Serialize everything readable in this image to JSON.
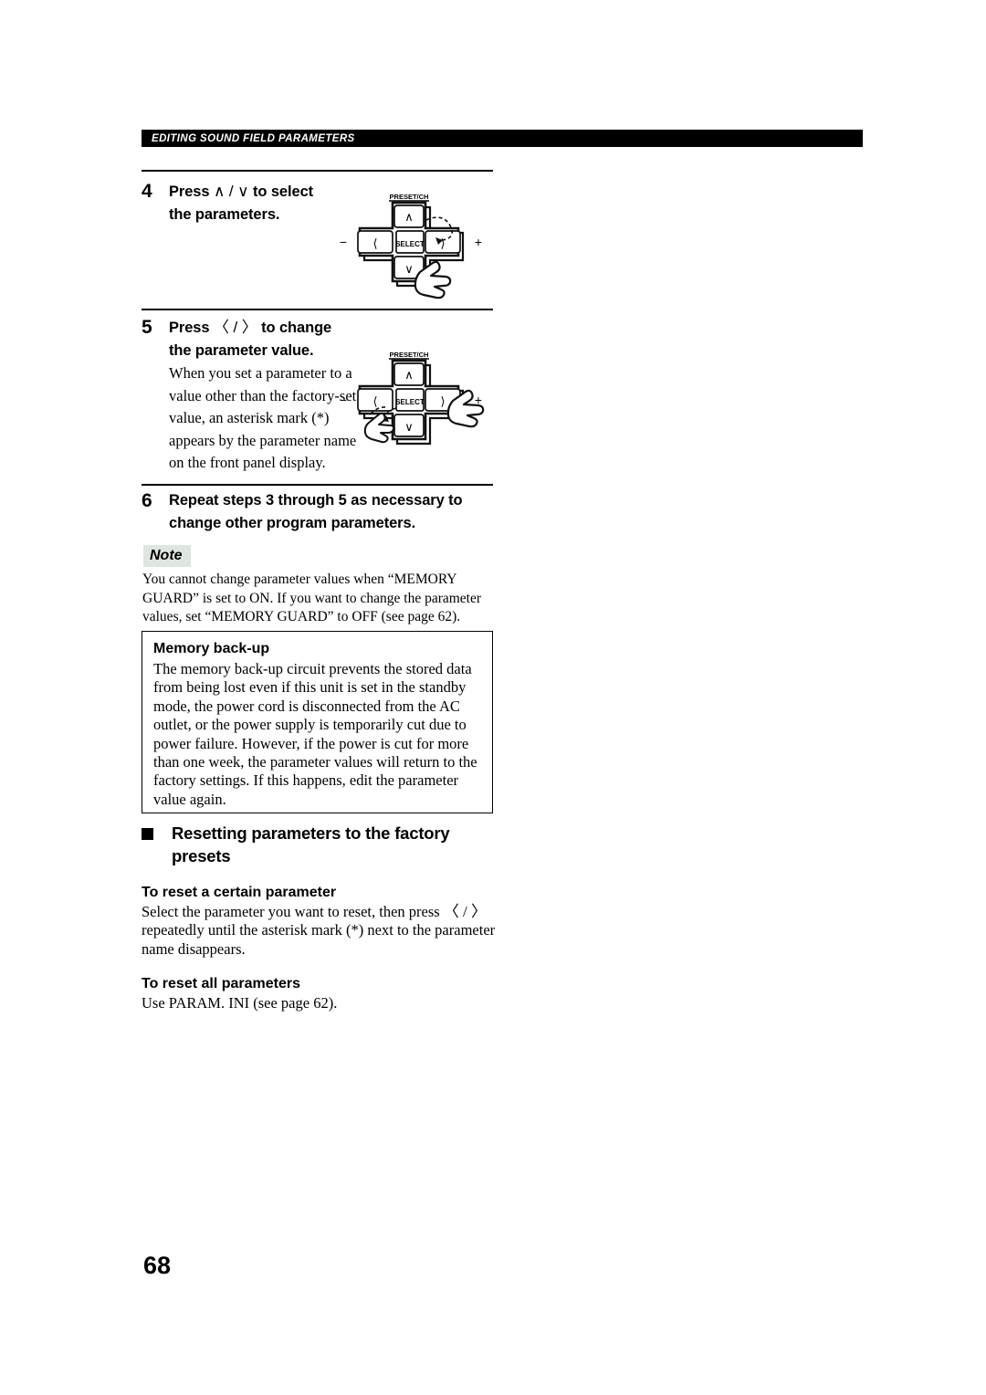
{
  "header": {
    "running_head": "EDITING SOUND FIELD PARAMETERS"
  },
  "steps": [
    {
      "number": "4",
      "title_pre": "Press ",
      "title_keys": "∧ / ∨",
      "title_post": " to select",
      "title_line2": "the parameters.",
      "body": ""
    },
    {
      "number": "5",
      "title_pre": "Press ",
      "title_keys": "〈 / 〉",
      "title_post": " to change",
      "title_line2": "the parameter value.",
      "body": "When you set a parameter to a value other than the factory-set value, an asterisk mark (*) appears by the parameter name on the front panel display."
    },
    {
      "number": "6",
      "title_pre": "Repeat steps 3 through 5 as necessary to",
      "title_keys": "",
      "title_post": "",
      "title_line2": "change other program parameters.",
      "body": ""
    }
  ],
  "dpad": {
    "preset_label": "PRESET/CH",
    "select_label": "SELECT",
    "up_glyph": "∧",
    "down_glyph": "∨",
    "left_glyph": "〈",
    "right_glyph": "〉",
    "minus_label": "−",
    "plus_label": "+"
  },
  "note": {
    "badge": "Note",
    "text": "You cannot change parameter values when “MEMORY GUARD” is set to ON. If you want to change the parameter values, set “MEMORY GUARD” to OFF (see page 62)."
  },
  "memory_box": {
    "title": "Memory back-up",
    "text": "The memory back-up circuit prevents the stored data from being lost even if this unit is set in the standby mode, the power cord is disconnected from the AC outlet, or the power supply is temporarily cut due to power failure. However, if the power is cut for more than one week, the parameter values will return to the factory settings. If this happens, edit the parameter value again."
  },
  "section": {
    "title_line1": "Resetting parameters to the factory",
    "title_line2": "presets",
    "sub1_head": "To reset a certain parameter",
    "sub1_text_pre": "Select the parameter you want to reset, then press ",
    "sub1_keys": "〈 / 〉",
    "sub1_text_post": " repeatedly until the asterisk mark (*) next to the parameter name disappears.",
    "sub2_head": "To reset all parameters",
    "sub2_text": "Use PARAM. INI (see page 62)."
  },
  "footer": {
    "page_number": "68"
  },
  "colors": {
    "header_band_bg": "#000000",
    "header_band_text": "#ffffff",
    "note_badge_bg": "#dfe5e0",
    "text": "#000000",
    "page_bg": "#ffffff"
  }
}
